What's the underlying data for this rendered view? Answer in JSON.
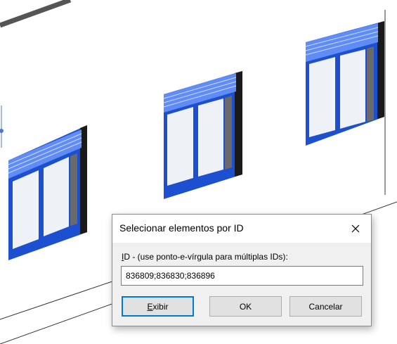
{
  "dialog": {
    "title": "Selecionar elementos por ID",
    "label_prefix": "I",
    "label_rest": "D - (use ponto-e-vírgula para múltiplas IDs):",
    "id_value": "836809;836830;836896",
    "buttons": {
      "show_prefix": "E",
      "show_rest": "xibir",
      "ok": "OK",
      "cancel": "Cancelar"
    }
  },
  "colors": {
    "window_frame": "#1d4fd1",
    "window_highlight": "#3d74f0",
    "glass": "#eef1f6",
    "focus": "#0078d7"
  }
}
